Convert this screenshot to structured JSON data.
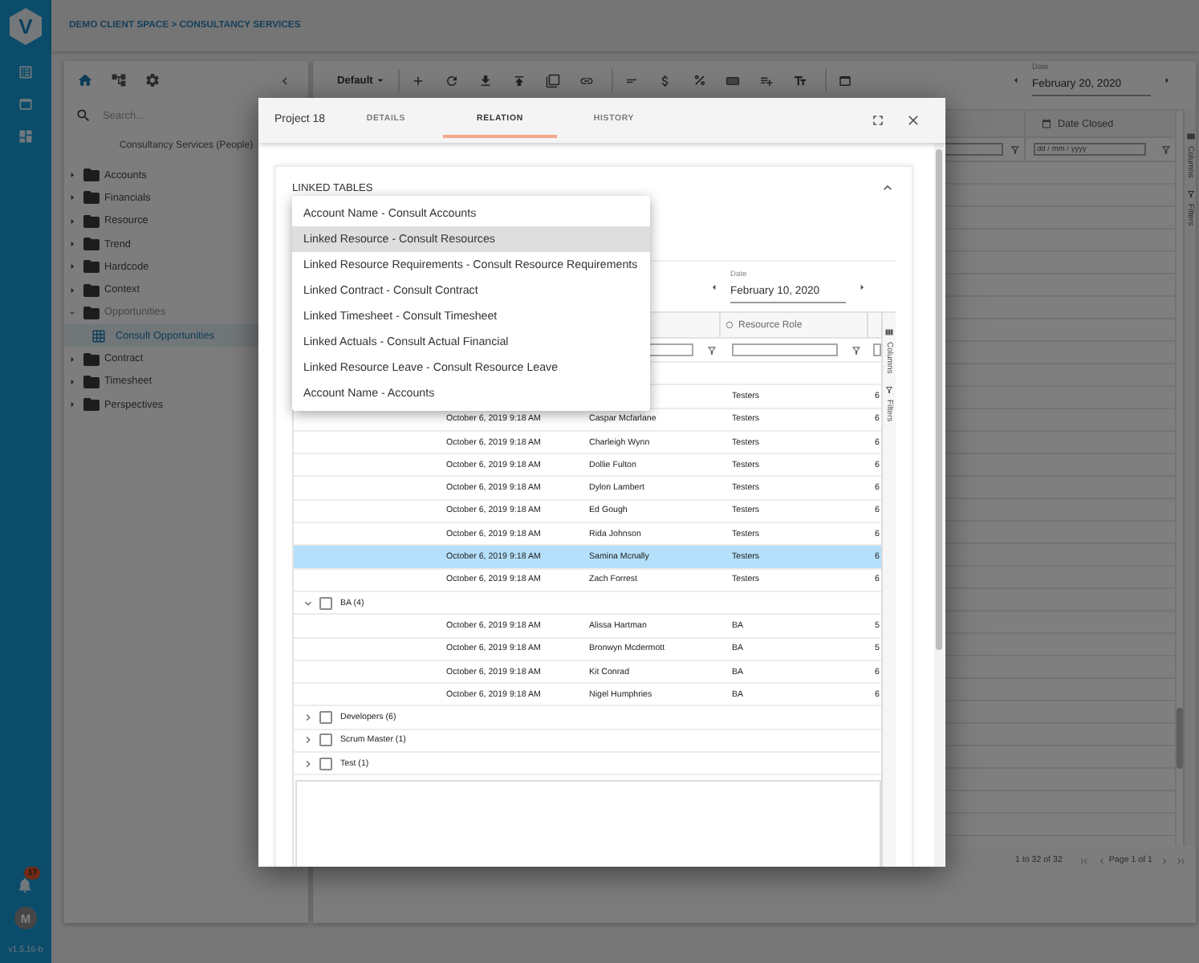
{
  "rail": {
    "logo": "V",
    "notifications": "17",
    "avatar": "M",
    "version": "v1.5.16-b"
  },
  "breadcrumb": "DEMO CLIENT SPACE > CONSULTANCY SERVICES",
  "explorer": {
    "search": {
      "placeholder": "Search..."
    },
    "root": "Consultancy Services (People)",
    "tree": [
      {
        "label": "Accounts",
        "expanded": false,
        "selected": false
      },
      {
        "label": "Financials",
        "expanded": false,
        "selected": false
      },
      {
        "label": "Resource",
        "expanded": false,
        "selected": false
      },
      {
        "label": "Trend",
        "expanded": false,
        "selected": false
      },
      {
        "label": "Hardcode",
        "expanded": false,
        "selected": false
      },
      {
        "label": "Context",
        "expanded": false,
        "selected": false
      },
      {
        "label": "Opportunities",
        "expanded": true,
        "selected": false,
        "children": [
          {
            "label": "Consult Opportunities",
            "selected": true
          }
        ]
      },
      {
        "label": "Contract",
        "expanded": false,
        "selected": false
      },
      {
        "label": "Timesheet",
        "expanded": false,
        "selected": false
      },
      {
        "label": "Perspectives",
        "expanded": false,
        "selected": false
      }
    ]
  },
  "toolbar": {
    "view": "Default",
    "date": {
      "label": "Date",
      "value": "February 20, 2020"
    }
  },
  "grid": {
    "columns": [
      {
        "label": "Date Closed",
        "filter_placeholder": "dd / mm / yyyy"
      }
    ],
    "side_tabs": [
      "Columns",
      "Filters"
    ],
    "pagination": {
      "range": "1 to 32 of 32",
      "page": "Page 1 of 1"
    }
  },
  "modal": {
    "title": "Project 18",
    "tabs": [
      {
        "label": "DETAILS",
        "selected": false
      },
      {
        "label": "RELATION",
        "selected": true
      },
      {
        "label": "HISTORY",
        "selected": false
      }
    ],
    "section": {
      "title": "LINKED TABLES",
      "expanded": true
    },
    "menu": [
      {
        "label": "Account Name - Consult Accounts",
        "selected": false
      },
      {
        "label": "Linked Resource - Consult Resources",
        "selected": true
      },
      {
        "label": "Linked Resource Requirements - Consult Resource Requirements",
        "selected": false
      },
      {
        "label": "Linked Contract - Consult Contract",
        "selected": false
      },
      {
        "label": "Linked Timesheet - Consult Timesheet",
        "selected": false
      },
      {
        "label": "Linked Actuals - Consult Actual Financial",
        "selected": false
      },
      {
        "label": "Linked Resource Leave - Consult Resource Leave",
        "selected": false
      },
      {
        "label": "Account Name - Accounts",
        "selected": false
      }
    ],
    "linked_grid": {
      "date": {
        "label": "Date",
        "value": "February 10, 2020"
      },
      "columns": [
        {
          "label": "Resource Role"
        }
      ],
      "side_tabs": [
        "Columns",
        "Filters"
      ],
      "rows": [
        {
          "kind": "row",
          "selected": false,
          "resource_role": "Testers",
          "column_4": "6"
        },
        {
          "kind": "row",
          "selected": false,
          "column_1": "October 6, 2019 9:18 AM",
          "column_2": "Caspar Mcfarlane",
          "resource_role": "Testers",
          "column_4": "6"
        },
        {
          "kind": "row",
          "selected": false,
          "column_1": "October 6, 2019 9:18 AM",
          "column_2": "Charleigh Wynn",
          "resource_role": "Testers",
          "column_4": "6"
        },
        {
          "kind": "row",
          "selected": false,
          "column_1": "October 6, 2019 9:18 AM",
          "column_2": "Dollie Fulton",
          "resource_role": "Testers",
          "column_4": "6"
        },
        {
          "kind": "row",
          "selected": false,
          "column_1": "October 6, 2019 9:18 AM",
          "column_2": "Dylon Lambert",
          "resource_role": "Testers",
          "column_4": "6"
        },
        {
          "kind": "row",
          "selected": false,
          "column_1": "October 6, 2019 9:18 AM",
          "column_2": "Ed Gough",
          "resource_role": "Testers",
          "column_4": "6"
        },
        {
          "kind": "row",
          "selected": false,
          "column_1": "October 6, 2019 9:18 AM",
          "column_2": "Rida Johnson",
          "resource_role": "Testers",
          "column_4": "6"
        },
        {
          "kind": "row",
          "selected": true,
          "column_1": "October 6, 2019 9:18 AM",
          "column_2": "Samina Mcnally",
          "resource_role": "Testers",
          "column_4": "6"
        },
        {
          "kind": "row",
          "selected": false,
          "column_1": "October 6, 2019 9:18 AM",
          "column_2": "Zach Forrest",
          "resource_role": "Testers",
          "column_4": "6"
        },
        {
          "kind": "group",
          "selected": false,
          "label": "BA (4)",
          "expanded": true,
          "checked": false
        },
        {
          "kind": "row",
          "selected": false,
          "column_1": "October 6, 2019 9:18 AM",
          "column_2": "Alissa Hartman",
          "resource_role": "BA",
          "column_4": "5"
        },
        {
          "kind": "row",
          "selected": false,
          "column_1": "October 6, 2019 9:18 AM",
          "column_2": "Bronwyn Mcdermott",
          "resource_role": "BA",
          "column_4": "5"
        },
        {
          "kind": "row",
          "selected": false,
          "column_1": "October 6, 2019 9:18 AM",
          "column_2": "Kit Conrad",
          "resource_role": "BA",
          "column_4": "6"
        },
        {
          "kind": "row",
          "selected": false,
          "column_1": "October 6, 2019 9:18 AM",
          "column_2": "Nigel Humphries",
          "resource_role": "BA",
          "column_4": "6"
        },
        {
          "kind": "group",
          "selected": false,
          "label": "Developers (6)",
          "expanded": false,
          "checked": false
        },
        {
          "kind": "group",
          "selected": false,
          "label": "Scrum Master (1)",
          "expanded": false,
          "checked": false
        },
        {
          "kind": "group",
          "selected": false,
          "label": "Test (1)",
          "expanded": false,
          "checked": false
        }
      ]
    }
  }
}
